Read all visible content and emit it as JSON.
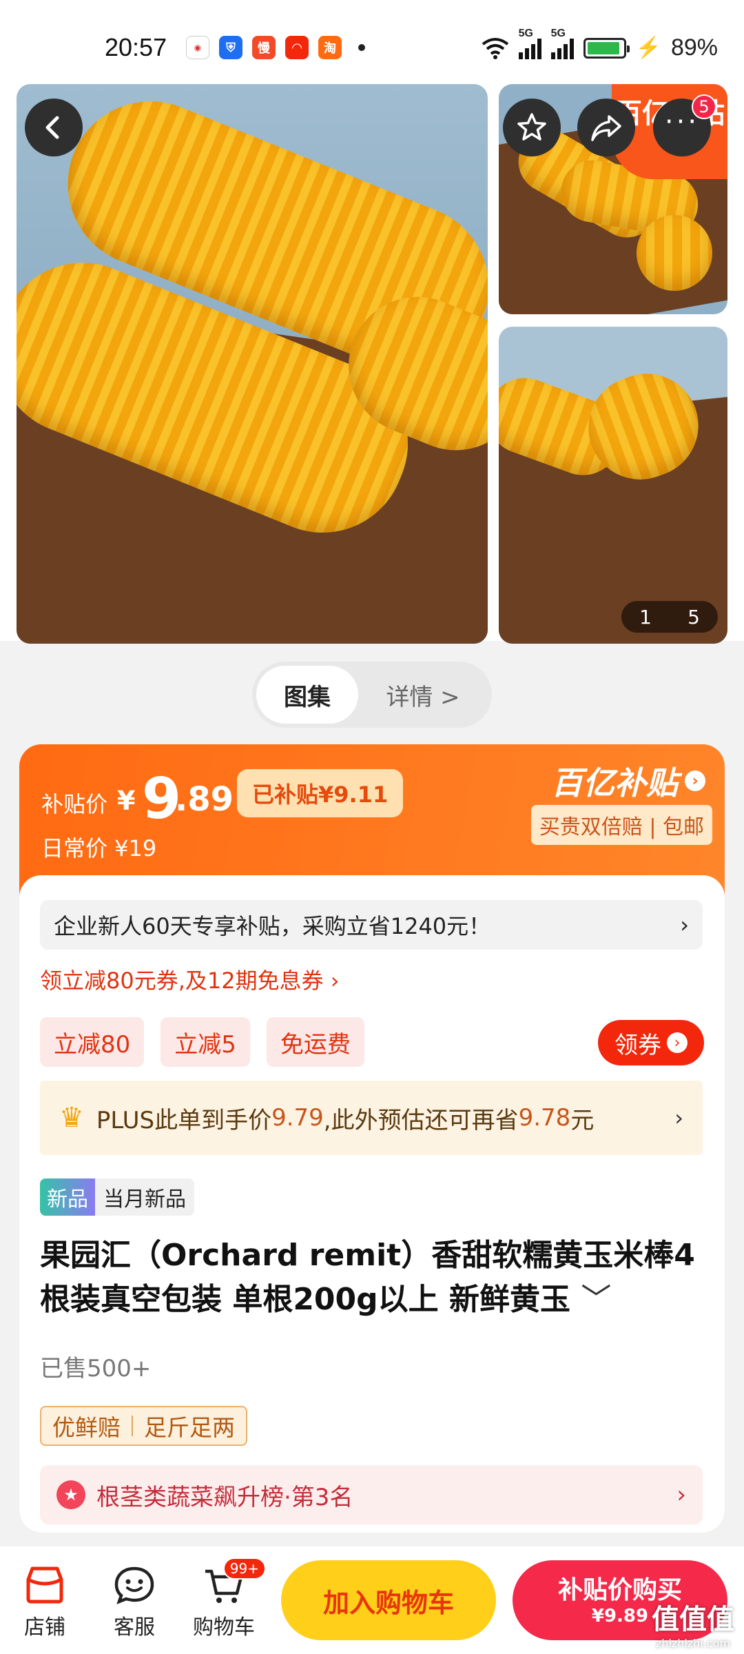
{
  "status": {
    "time": "20:57",
    "battery": "89%",
    "net1": "5G",
    "net2": "5G",
    "app_icons": [
      "realme-app-icon",
      "shield-app-icon",
      "man-app-icon",
      "jd-app-icon",
      "taobao-app-icon"
    ]
  },
  "header": {
    "cart_badge": "5"
  },
  "gallery": {
    "subsidy_tag": "百亿补贴",
    "current_page": "1",
    "total_pages": "5"
  },
  "tabs": {
    "active": "图集",
    "other": "详情 >"
  },
  "price": {
    "label": "补贴价",
    "currency": "¥",
    "integer": "9",
    "decimal": ".89",
    "subsidized": "已补贴¥9.11",
    "daily": "日常价 ¥19",
    "brand": "百亿补贴",
    "promise": "买贵双倍赔 | 包邮"
  },
  "promo": {
    "business": "企业新人60天专享补贴，采购立省1240元！",
    "coupon_line": "领立减80元券,及12期免息券 ›",
    "chips": [
      "立减80",
      "立减5",
      "免运费"
    ],
    "get_coupon": "领券",
    "plus_prefix": "PLUS此单到手价",
    "plus_price": "9.79",
    "plus_mid": ",此外预估还可再省",
    "plus_save": "9.78",
    "plus_suffix": "元"
  },
  "product": {
    "tag_a": "新品",
    "tag_b": "当月新品",
    "title": "果园汇（Orchard remit）香甜软糯黄玉米棒4根装真空包装 单根200g以上 新鲜黄玉",
    "sold": "已售500+",
    "guarantee_1": "优鲜赔",
    "guarantee_2": "足斤足两",
    "rank": "根茎类蔬菜飙升榜·第3名"
  },
  "bottom": {
    "store": "店铺",
    "service": "客服",
    "cart": "购物车",
    "cart_badge": "99+",
    "add_cart": "加入购物车",
    "buy_l1": "补贴价购买",
    "buy_l2": "¥9.89",
    "watermark": "值值值",
    "watermark_sub": "zhizhizhi.com"
  },
  "colors": {
    "accent": "#ff6a12",
    "red": "#f2270c",
    "yellow": "#ffcf1a"
  }
}
